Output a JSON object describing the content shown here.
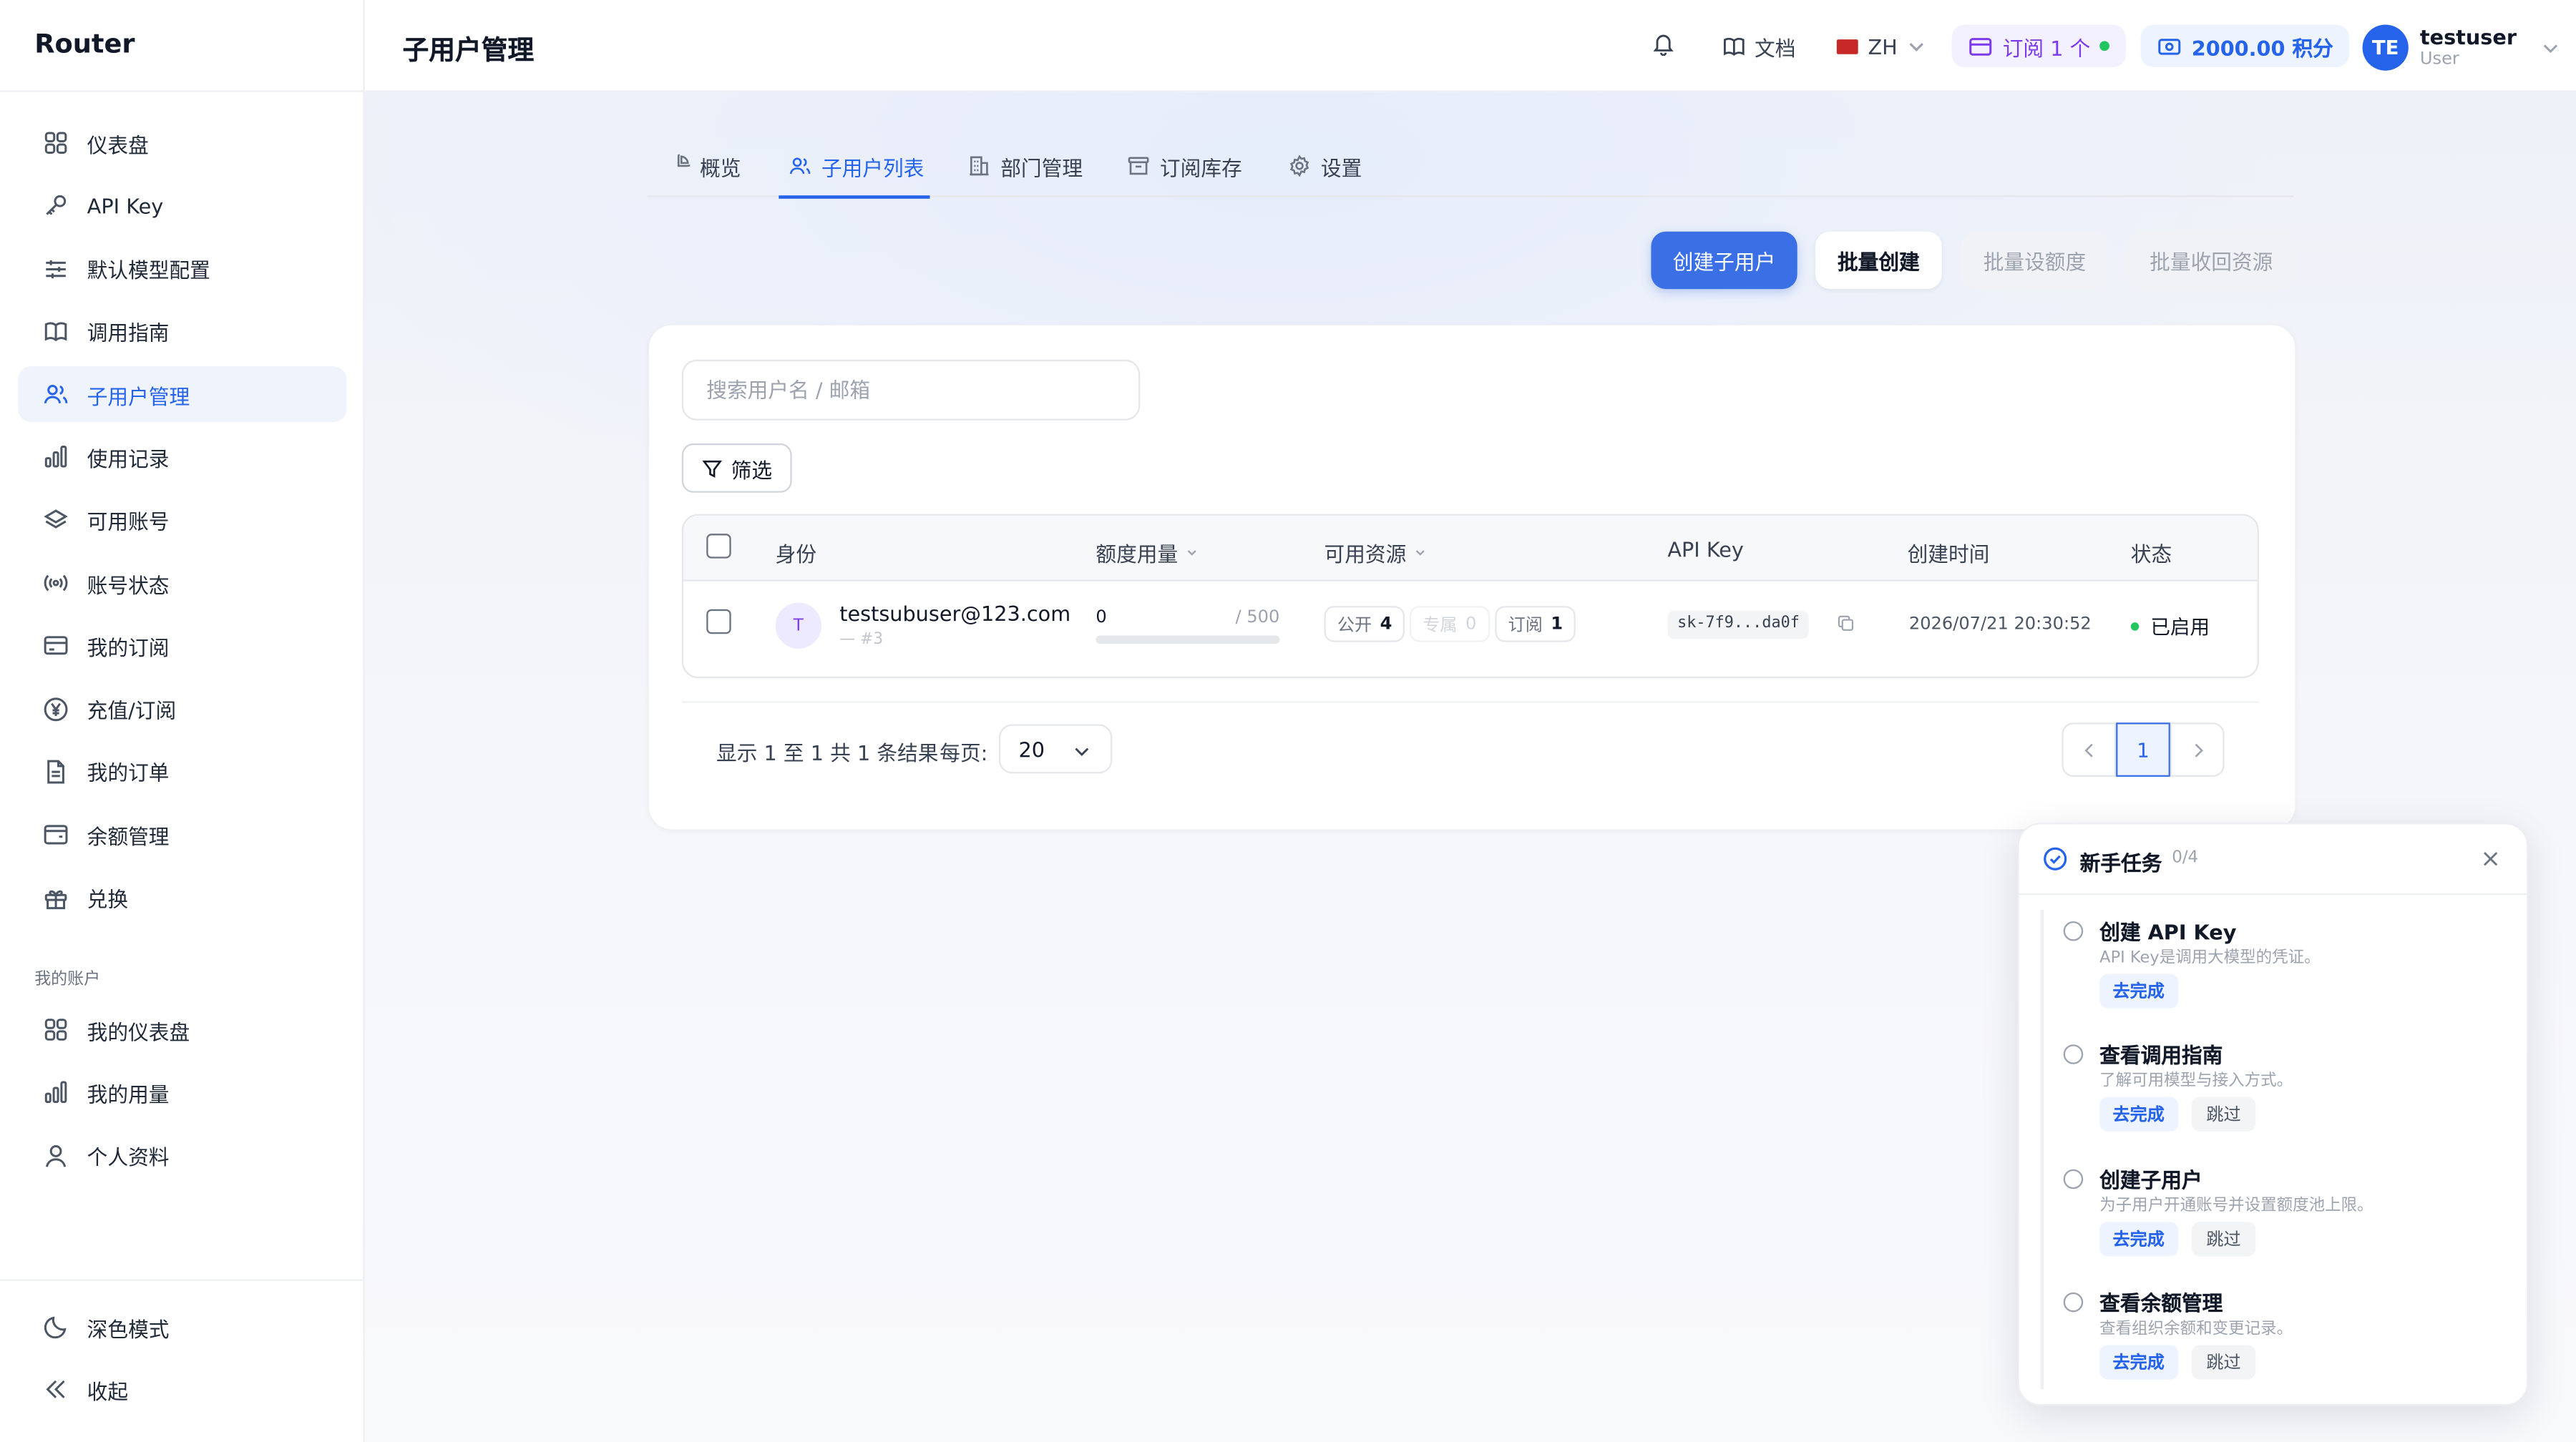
{
  "app": {
    "brand": "Router",
    "page_title": "子用户管理"
  },
  "sidebar": {
    "items": [
      {
        "label": "仪表盘",
        "icon": "dashboard-icon"
      },
      {
        "label": "API Key",
        "icon": "key-icon"
      },
      {
        "label": "默认模型配置",
        "icon": "sliders-icon"
      },
      {
        "label": "调用指南",
        "icon": "book-icon"
      },
      {
        "label": "子用户管理",
        "icon": "users-icon",
        "active": true
      },
      {
        "label": "使用记录",
        "icon": "bar-chart-icon"
      },
      {
        "label": "可用账号",
        "icon": "layers-icon"
      },
      {
        "label": "账号状态",
        "icon": "radio-icon"
      },
      {
        "label": "我的订阅",
        "icon": "card-icon"
      },
      {
        "label": "充值/订阅",
        "icon": "yen-icon"
      },
      {
        "label": "我的订单",
        "icon": "file-icon"
      },
      {
        "label": "余额管理",
        "icon": "wallet-icon"
      },
      {
        "label": "兑换",
        "icon": "gift-icon"
      }
    ],
    "section_label": "我的账户",
    "account_items": [
      {
        "label": "我的仪表盘",
        "icon": "dashboard-icon"
      },
      {
        "label": "我的用量",
        "icon": "bar-chart-icon"
      },
      {
        "label": "个人资料",
        "icon": "user-icon"
      }
    ],
    "dark_mode_label": "深色模式",
    "collapse_label": "收起"
  },
  "topbar": {
    "docs_label": "文档",
    "lang_label": "ZH",
    "subscription_label": "订阅 1 个",
    "points_label": "2000.00 积分",
    "avatar_initials": "TE",
    "username": "testuser",
    "role": "User"
  },
  "tabs": [
    {
      "label": "概览",
      "icon": "chart-pie-icon"
    },
    {
      "label": "子用户列表",
      "icon": "users-icon",
      "active": true
    },
    {
      "label": "部门管理",
      "icon": "building-icon"
    },
    {
      "label": "订阅库存",
      "icon": "archive-icon"
    },
    {
      "label": "设置",
      "icon": "gear-icon"
    }
  ],
  "actions": {
    "create": "创建子用户",
    "batch_create": "批量创建",
    "batch_quota": "批量设额度",
    "batch_revoke": "批量收回资源"
  },
  "search": {
    "placeholder": "搜索用户名 / 邮箱",
    "value": ""
  },
  "filter_label": "筛选",
  "table": {
    "columns": [
      "身份",
      "额度用量",
      "可用资源",
      "API Key",
      "创建时间",
      "状态"
    ],
    "rows": [
      {
        "avatar": "T",
        "email": "testsubuser@123.com",
        "id": "— #3",
        "quota_used": "0",
        "quota_total": "/ 500",
        "quota_fraction": 0,
        "res_public_label": "公开",
        "res_public_count": "4",
        "res_exclusive_label": "专属",
        "res_exclusive_count": "0",
        "res_sub_label": "订阅",
        "res_sub_count": "1",
        "api_key": "sk-7f9...da0f",
        "created": "2026/07/21 20:30:52",
        "status": "已启用"
      }
    ]
  },
  "pagination": {
    "info": "显示 1 至 1 共 1 条结果",
    "per_page_label": "每页:",
    "per_page": "20",
    "current_page": "1"
  },
  "onboarding": {
    "title": "新手任务",
    "progress": "0/4",
    "go_label": "去完成",
    "skip_label": "跳过",
    "tasks": [
      {
        "title": "创建 API Key",
        "desc": "API Key是调用大模型的凭证。"
      },
      {
        "title": "查看调用指南",
        "desc": "了解可用模型与接入方式。"
      },
      {
        "title": "创建子用户",
        "desc": "为子用户开通账号并设置额度池上限。"
      },
      {
        "title": "查看余额管理",
        "desc": "查看组织余额和变更记录。"
      }
    ]
  },
  "colors": {
    "accent": "#3b6fe6",
    "status_ok": "#22c55e",
    "subscription": "#7c3aed"
  }
}
